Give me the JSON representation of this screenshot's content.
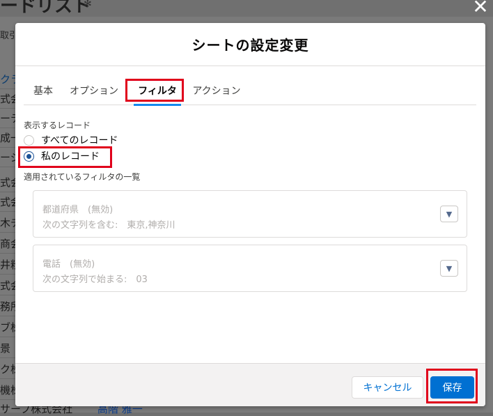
{
  "background": {
    "title": "ードリスト",
    "gear_icon": "gear-icon",
    "close_icon": "close-icon",
    "tab_label": "取引",
    "rows": [
      "クラ",
      "式会",
      "ーテ",
      "成一",
      "ージェ",
      "式会",
      "式会",
      "木チ",
      "商会",
      "井粉",
      "式会",
      "務所",
      "ブ株",
      "景",
      "ク株",
      "機株"
    ],
    "footer_text": "サーブ株式会社",
    "footer_link": "高階 雅一"
  },
  "modal": {
    "title": "シートの設定変更",
    "tabs": [
      {
        "label": "基本",
        "active": false
      },
      {
        "label": "オプション",
        "active": false
      },
      {
        "label": "フィルタ",
        "active": true
      },
      {
        "label": "アクション",
        "active": false
      }
    ],
    "records_label": "表示するレコード",
    "options": [
      {
        "label": "すべてのレコード",
        "checked": false
      },
      {
        "label": "私のレコード",
        "checked": true
      }
    ],
    "filters_label": "適用されているフィルタの一覧",
    "filters": [
      {
        "field": "都道府県　(無効)",
        "condition": "次の文字列を含む:　東京,神奈川"
      },
      {
        "field": "電話　(無効)",
        "condition": "次の文字列で始まる:　03"
      }
    ],
    "dropdown_icon": "chevron-down-icon",
    "cancel_label": "キャンセル",
    "save_label": "保存"
  },
  "colors": {
    "accent": "#0070d2",
    "highlight_box": "#e0001b",
    "tab_underline": "#1589ee"
  }
}
